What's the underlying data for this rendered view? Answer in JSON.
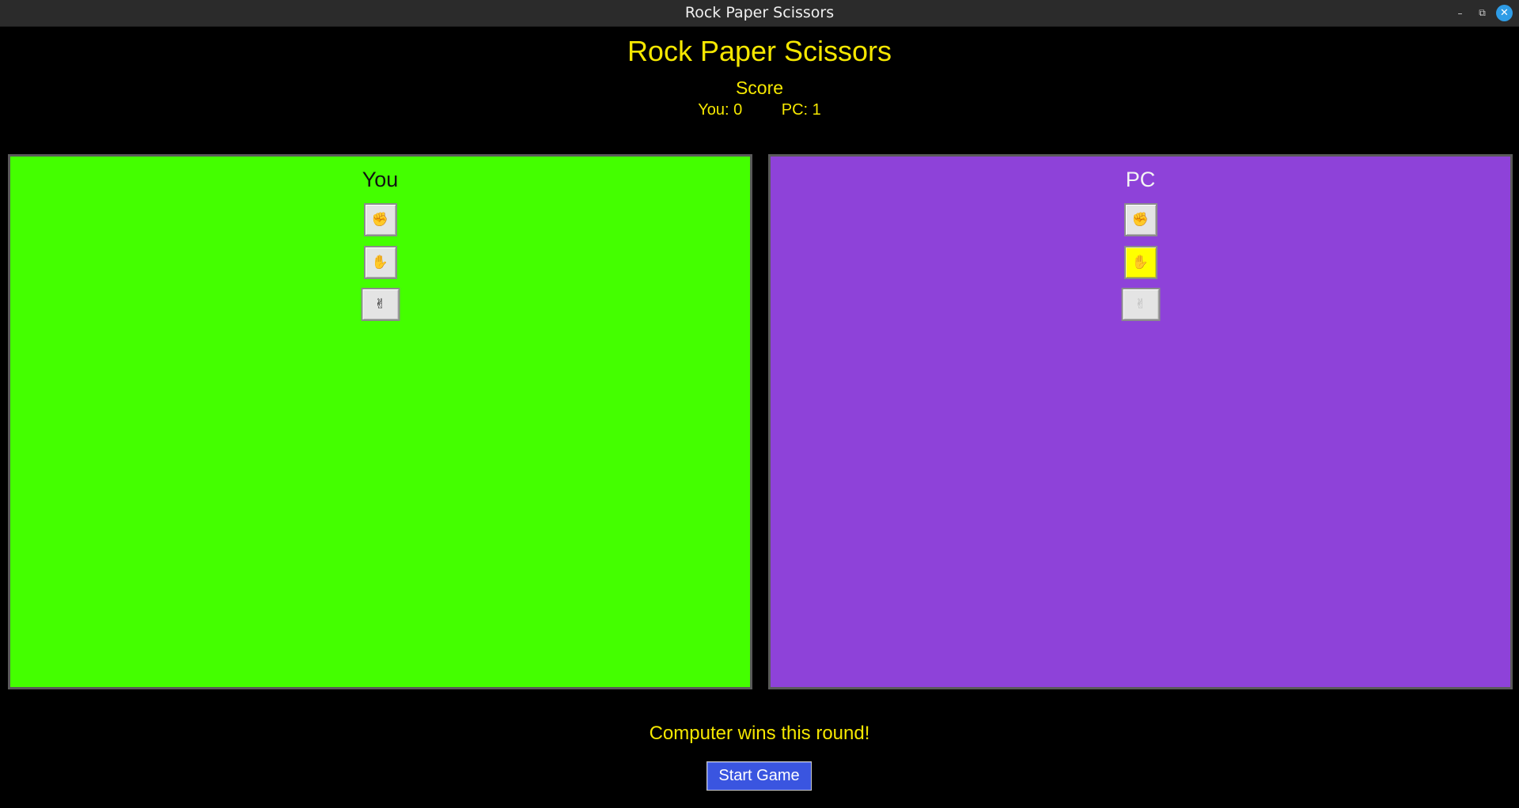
{
  "window": {
    "title": "Rock Paper Scissors",
    "controls": {
      "minimize": "–",
      "maximize": "⧉",
      "close": "✕"
    }
  },
  "game": {
    "title": "Rock Paper Scissors",
    "score_heading": "Score",
    "score_you": "You: 0",
    "score_pc": "PC: 1"
  },
  "panels": {
    "you": {
      "label": "You",
      "background": "#44ff00",
      "choices": [
        {
          "name": "rock",
          "glyph": "✊"
        },
        {
          "name": "paper",
          "glyph": "✋"
        },
        {
          "name": "scissors",
          "glyph": "✌"
        }
      ]
    },
    "pc": {
      "label": "PC",
      "background": "#8e42d9",
      "selected_choice": "paper",
      "highlight_color": "#ffff00",
      "choices": [
        {
          "name": "rock",
          "glyph": "✊"
        },
        {
          "name": "paper",
          "glyph": "✋"
        },
        {
          "name": "scissors",
          "glyph": "✌"
        }
      ]
    }
  },
  "result_message": "Computer wins this round!",
  "start_button": {
    "label": "Start Game",
    "color": "#3a55e0"
  }
}
